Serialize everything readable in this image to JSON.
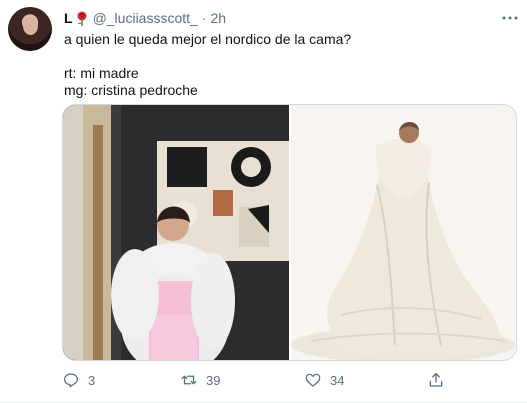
{
  "tweet": {
    "author": {
      "display_name": "L",
      "display_emoji": "rose",
      "handle": "@_luciiassscott_",
      "separator": "·",
      "time": "2h"
    },
    "text_lines": [
      "a quien le queda mejor el nordico de la cama?",
      "",
      "rt: mi madre",
      "mg: cristina pedroche"
    ],
    "media": {
      "count": 2
    },
    "actions": {
      "reply_count": "3",
      "retweet_count": "39",
      "like_count": "34"
    },
    "icons": {
      "more": "more-options-icon",
      "reply": "reply-icon",
      "retweet": "retweet-icon",
      "like": "like-icon",
      "share": "share-icon"
    },
    "colors": {
      "text": "#0f1419",
      "secondary": "#5b7083",
      "border": "#cfd9de"
    }
  }
}
